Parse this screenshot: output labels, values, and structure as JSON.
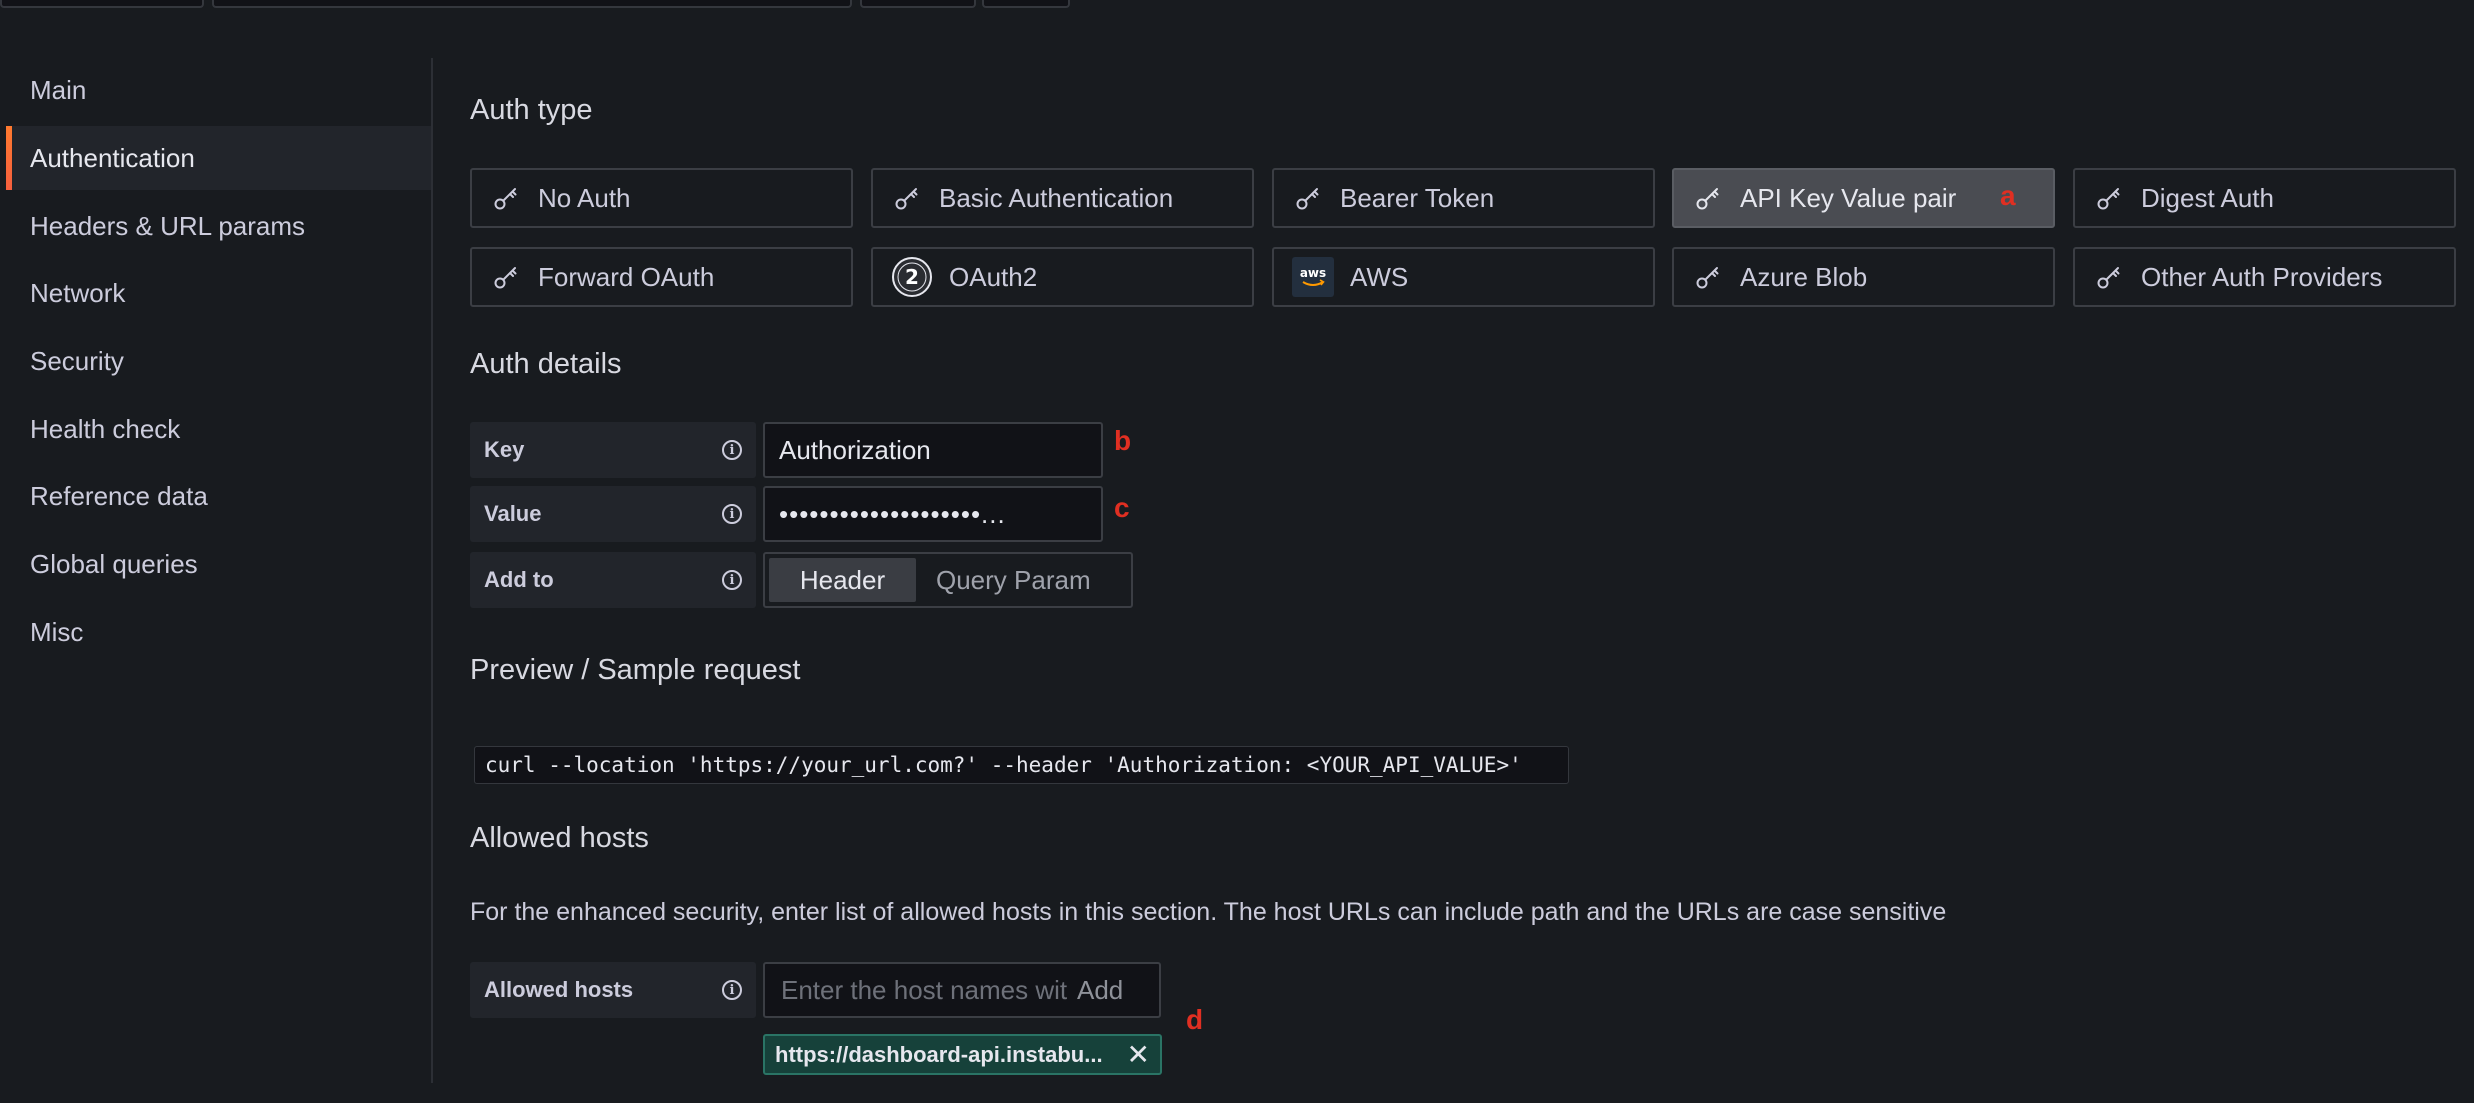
{
  "sidebar": {
    "items": [
      {
        "label": "Main"
      },
      {
        "label": "Authentication"
      },
      {
        "label": "Headers & URL params"
      },
      {
        "label": "Network"
      },
      {
        "label": "Security"
      },
      {
        "label": "Health check"
      },
      {
        "label": "Reference data"
      },
      {
        "label": "Global queries"
      },
      {
        "label": "Misc"
      }
    ],
    "active_index": 1
  },
  "auth_type": {
    "heading": "Auth type",
    "options": [
      {
        "label": "No Auth",
        "icon": "key-icon"
      },
      {
        "label": "Basic Authentication",
        "icon": "key-icon"
      },
      {
        "label": "Bearer Token",
        "icon": "key-icon"
      },
      {
        "label": "API Key Value pair",
        "icon": "key-icon",
        "selected": true
      },
      {
        "label": "Digest Auth",
        "icon": "key-icon"
      },
      {
        "label": "Forward OAuth",
        "icon": "key-icon"
      },
      {
        "label": "OAuth2",
        "icon": "oauth2-icon"
      },
      {
        "label": "AWS",
        "icon": "aws-icon"
      },
      {
        "label": "Azure Blob",
        "icon": "key-icon"
      },
      {
        "label": "Other Auth Providers",
        "icon": "key-icon"
      }
    ]
  },
  "annotations": {
    "a": "a",
    "b": "b",
    "c": "c",
    "d": "d"
  },
  "auth_details": {
    "heading": "Auth details",
    "key": {
      "label": "Key",
      "value": "Authorization"
    },
    "value": {
      "label": "Value",
      "value": "••••••••••••••••••••..."
    },
    "add_to": {
      "label": "Add to",
      "options": [
        "Header",
        "Query Param"
      ],
      "selected": "Header"
    }
  },
  "preview": {
    "heading": "Preview / Sample request",
    "code": "curl --location 'https://your_url.com?' --header 'Authorization: <YOUR_API_VALUE>'"
  },
  "allowed_hosts": {
    "heading": "Allowed hosts",
    "description": "For the enhanced security, enter list of allowed hosts in this section. The host URLs can include path and the URLs are case sensitive",
    "label": "Allowed hosts",
    "placeholder": "Enter the host names with",
    "add_label": "Add",
    "hosts": [
      "https://dashboard-api.instabu..."
    ]
  },
  "colors": {
    "background": "#181b1f",
    "selected_option": "#4a4c52",
    "accent": "#ff7a2f",
    "annotation": "#e02f22",
    "tag_bg": "#16413a"
  }
}
